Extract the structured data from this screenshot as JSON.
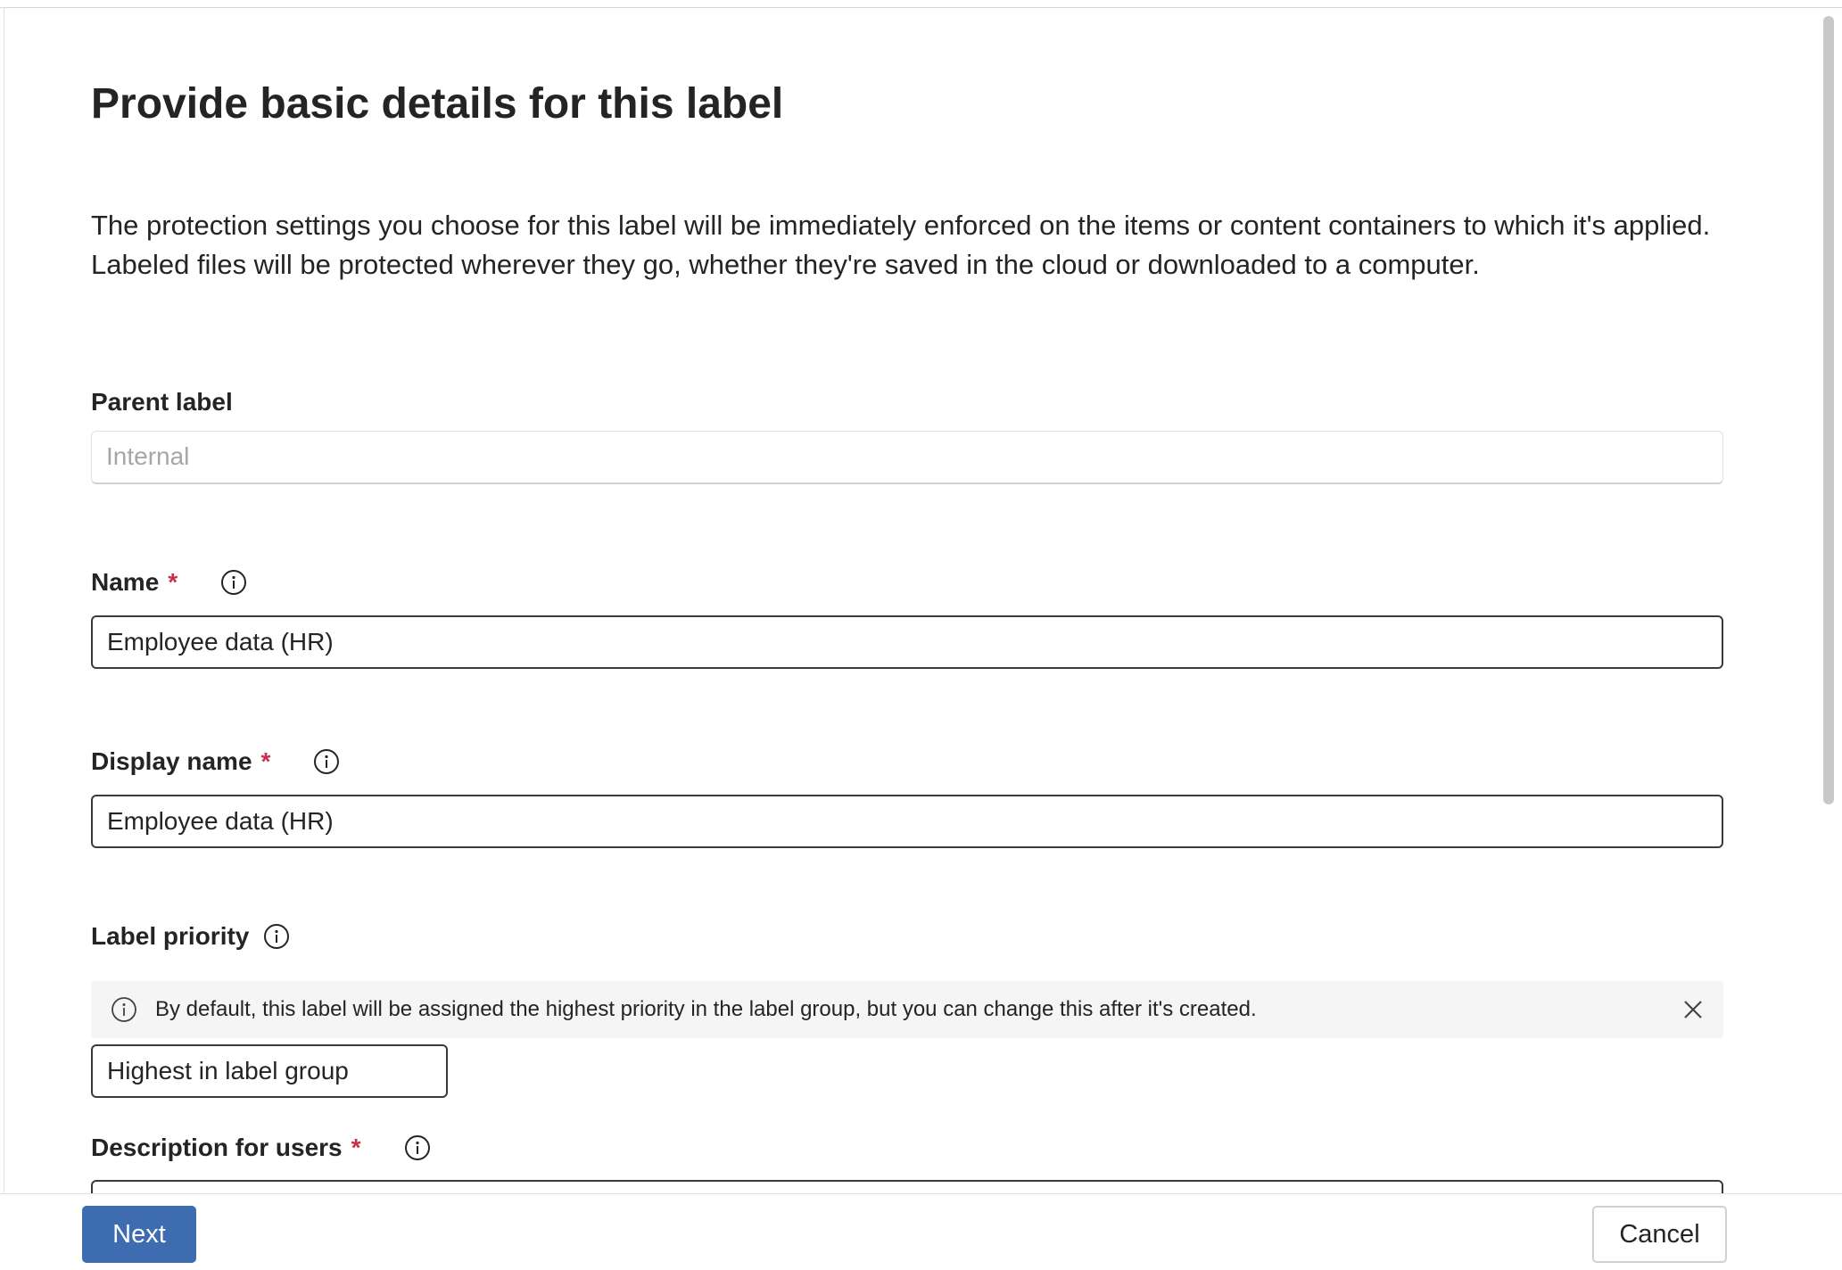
{
  "page": {
    "title": "Provide basic details for this label",
    "description": "The protection settings you choose for this label will be immediately enforced on the items or content containers to which it's applied. Labeled files will be protected wherever they go, whether they're saved in the cloud or downloaded to a computer."
  },
  "fields": {
    "parent_label": {
      "label": "Parent label",
      "value": "Internal"
    },
    "name": {
      "label": "Name",
      "required_marker": "*",
      "value": "Employee data (HR)",
      "info_icon": "info-icon"
    },
    "display_name": {
      "label": "Display name",
      "required_marker": "*",
      "value": "Employee data (HR)",
      "info_icon": "info-icon"
    },
    "label_priority": {
      "label": "Label priority",
      "info_icon": "info-icon",
      "message": "By default, this label will be assigned the highest priority in the label group, but you can change this after it's created.",
      "value": "Highest in label group"
    },
    "description_for_users": {
      "label": "Description for users",
      "required_marker": "*",
      "info_icon": "info-icon"
    }
  },
  "footer": {
    "next_label": "Next",
    "cancel_label": "Cancel"
  },
  "colors": {
    "primary_button": "#3d6cb0",
    "required_marker": "#c4314b",
    "message_bar_bg": "#f5f5f5"
  }
}
